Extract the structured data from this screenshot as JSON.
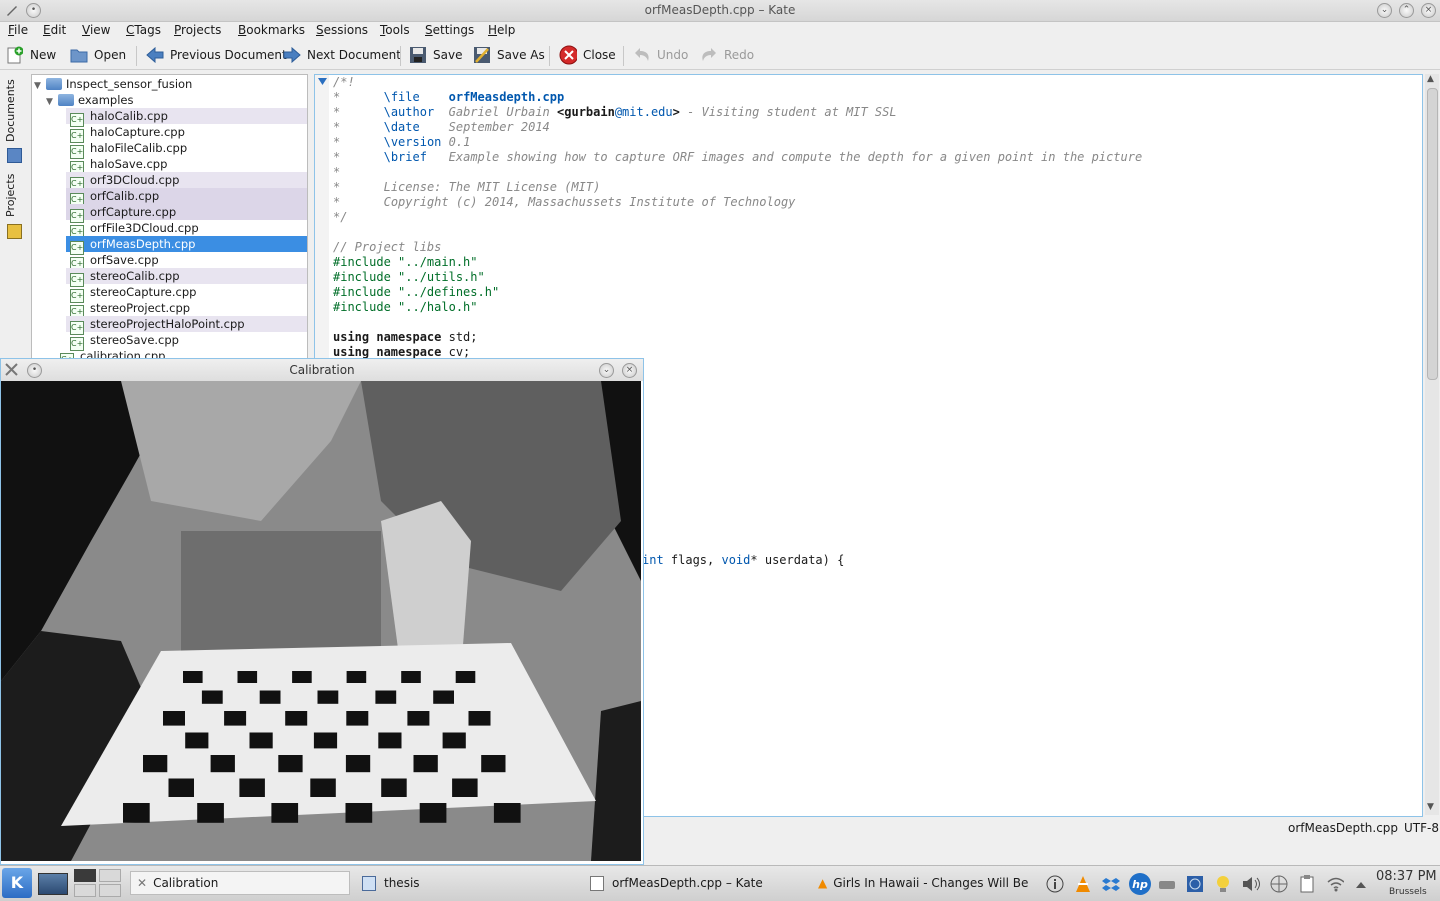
{
  "window": {
    "title": "orfMeasDepth.cpp – Kate"
  },
  "menu": [
    {
      "label": "File",
      "u": "F",
      "rest": "ile"
    },
    {
      "label": "Edit",
      "u": "E",
      "rest": "dit"
    },
    {
      "label": "View",
      "u": "V",
      "rest": "iew"
    },
    {
      "label": "CTags",
      "u": "C",
      "rest": "Tags"
    },
    {
      "label": "Projects",
      "u": "P",
      "rest": "rojects"
    },
    {
      "label": "Bookmarks",
      "u": "B",
      "rest": "ookmarks"
    },
    {
      "label": "Sessions",
      "u": "S",
      "rest": "essions"
    },
    {
      "label": "Tools",
      "u": "T",
      "rest": "ools"
    },
    {
      "label": "Settings",
      "u": "S",
      "rest": "ettings"
    },
    {
      "label": "Help",
      "u": "H",
      "rest": "elp"
    }
  ],
  "toolbar": {
    "new": "New",
    "open": "Open",
    "previous": "Previous Document",
    "next": "Next Document",
    "save": "Save",
    "save_as": "Save As",
    "close": "Close",
    "undo": "Undo",
    "redo": "Redo"
  },
  "side_tabs": {
    "documents": "Documents",
    "projects": "Projects"
  },
  "tree": {
    "root": "Inspect_sensor_fusion",
    "folder": "examples",
    "files": [
      "haloCalib.cpp",
      "haloCapture.cpp",
      "haloFileCalib.cpp",
      "haloSave.cpp",
      "orf3DCloud.cpp",
      "orfCalib.cpp",
      "orfCapture.cpp",
      "orfFile3DCloud.cpp",
      "orfMeasDepth.cpp",
      "orfSave.cpp",
      "stereoCalib.cpp",
      "stereoCapture.cpp",
      "stereoProject.cpp",
      "stereoProjectHaloPoint.cpp",
      "stereoSave.cpp"
    ],
    "selected": "orfMeasDepth.cpp",
    "extra": "calibration.cpp"
  },
  "code": {
    "open": "/*!",
    "file_tag": "\\file",
    "file_val": "orfMeasdepth.cpp",
    "author_tag": "\\author",
    "author_name": "Gabriel Urbain",
    "author_email_pre": "<",
    "author_email_user": "gurbain",
    "author_email_at": "@mit.edu",
    "author_email_post": ">",
    "author_rest": " - Visiting student at MIT SSL",
    "date_tag": "\\date",
    "date_val": "September 2014",
    "version_tag": "\\version",
    "version_val": "0.1",
    "brief_tag": "\\brief",
    "brief_val": "Example showing how to capture ORF images and compute the depth for a given point in the picture",
    "star": "*",
    "license": "License: The MIT License (MIT)",
    "copyright": "Copyright (c) 2014, Massachussets Institute of Technology",
    "close": "*/",
    "libs_comment": "// Project libs",
    "inc1": "#include \"../main.h\"",
    "inc2": "#include \"../utils.h\"",
    "inc3": "#include \"../defines.h\"",
    "inc4": "#include \"../halo.h\"",
    "using1_kw": "using namespace",
    "using1_v": " std;",
    "using2_kw": "using namespace",
    "using2_v": " cv;",
    "partial_int": "int",
    "partial_rest1": " flags, ",
    "partial_void": "void",
    "partial_rest2": "* userdata) {"
  },
  "status": {
    "file": "orfMeasDepth.cpp",
    "encoding": "UTF-8"
  },
  "calibration": {
    "title": "Calibration"
  },
  "taskbar": {
    "tasks": [
      "Calibration",
      "thesis",
      "orfMeasDepth.cpp – Kate",
      "Girls In Hawaii - Changes Will Be Lo"
    ],
    "time": "08:37 PM",
    "city": "Brussels"
  },
  "colors": {
    "accent": "#3a8ee6",
    "selection": "#3b8ee3",
    "doc_highlight": "#e8e4f0"
  }
}
